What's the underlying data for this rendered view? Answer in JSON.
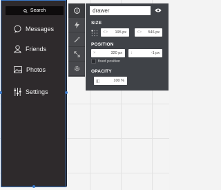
{
  "drawer": {
    "search_label": "Search",
    "menu": [
      {
        "label": "Messages",
        "icon": "chat-bubble-icon"
      },
      {
        "label": "Friends",
        "icon": "user-icon"
      },
      {
        "label": "Photos",
        "icon": "photo-icon"
      },
      {
        "label": "Settings",
        "icon": "sliders-icon"
      }
    ]
  },
  "toolstrip": {
    "tools": [
      "info-icon",
      "lightning-icon",
      "magic-wand-icon",
      "expand-icon",
      "gear-icon"
    ]
  },
  "panel": {
    "name_value": "drawer",
    "size_label": "SIZE",
    "width": "195 px",
    "height": "546 px",
    "position_label": "POSITION",
    "x": "320 px",
    "y": "-1 px",
    "fixed_position_label": "fixed position",
    "opacity_label": "OPACITY",
    "opacity": "100 %"
  },
  "colors": {
    "drawer_bg": "#2e2a2c",
    "panel_bg": "#3f4247",
    "toolstrip_bg": "#47484c",
    "selection": "#3a79c9"
  }
}
